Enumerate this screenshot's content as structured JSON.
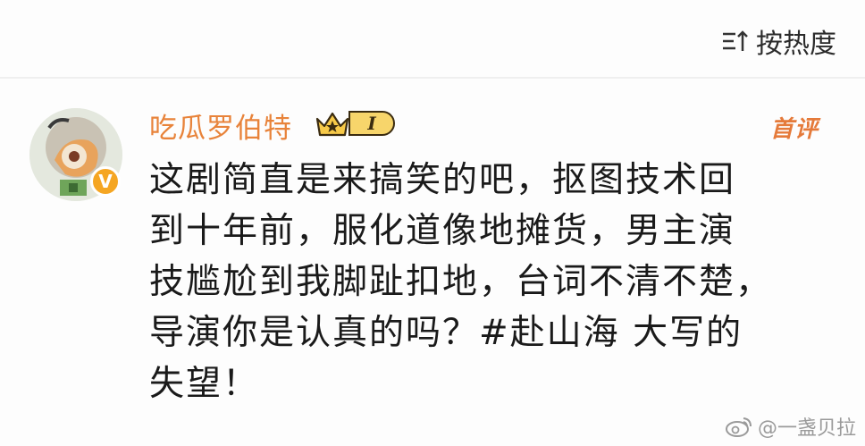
{
  "sort": {
    "label": "按热度",
    "icon": "sort-icon"
  },
  "comment": {
    "username": "吃瓜罗伯特",
    "level": "I",
    "verified_badge": "V",
    "first_comment_tag": "首评",
    "lines": [
      "这剧简直是来搞笑的吧，抠图技术回",
      "到十年前，服化道像地摊货，男主演",
      "技尴尬到我脚趾扣地，台词不清不楚，",
      "导演你是认真的吗？#赴山海 大写的",
      "失望！"
    ]
  },
  "watermark": {
    "text": "@一盏贝拉",
    "icon": "weibo-icon"
  },
  "colors": {
    "username": "#e8833a",
    "first_comment": "#e57a3a",
    "text": "#1a1a1a",
    "badge": "#f5a623"
  }
}
